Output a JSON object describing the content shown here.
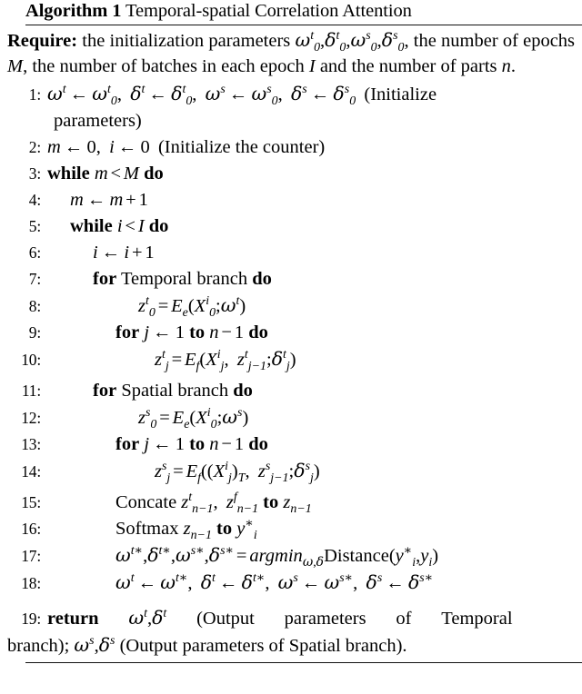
{
  "document": {
    "type": "algorithm-pseudocode",
    "title_keyword": "Algorithm",
    "title_number": "1",
    "title_name": "Temporal-spatial Correlation Attention",
    "full_title": "Algorithm 1 Temporal-spatial Correlation Attention"
  },
  "require": {
    "keyword": "Require:",
    "text": "the initialization parameters ω0t, δ0t, ω0s, δ0s, the number of epochs M, the number of batches in each epoch I and the number of parts n.",
    "segments": {
      "s1": "the",
      "s2": "initialization",
      "s3": "parameters",
      "s4": ", the number of epochs",
      "s5": ", the number of batches in each epoch",
      "s6": "and the number of parts",
      "s7": "."
    },
    "symbols": {
      "omega_0_t": "ω0t",
      "delta_0_t": "δ0t",
      "omega_0_s": "ω0s",
      "delta_0_s": "δ0s",
      "M": "M",
      "I": "I",
      "n": "n"
    }
  },
  "lines": [
    {
      "num": "1:",
      "indent": 0,
      "text": "ωt ← ω0t, δt ← δ0t, ωs ← ω0s, δs ← δ0s (Initialize parameters)",
      "comment": "(Initialize parameters)"
    },
    {
      "num": "2:",
      "indent": 0,
      "text": "m ← 0, i ← 0 (Initialize the counter)",
      "comment": "(Initialize the counter)"
    },
    {
      "num": "3:",
      "indent": 0,
      "keywords": [
        "while",
        "do"
      ],
      "text": "while m < M do"
    },
    {
      "num": "4:",
      "indent": 1,
      "text": "m ← m + 1"
    },
    {
      "num": "5:",
      "indent": 1,
      "keywords": [
        "while",
        "do"
      ],
      "text": "while i < I do"
    },
    {
      "num": "6:",
      "indent": 2,
      "text": "i ← i + 1"
    },
    {
      "num": "7:",
      "indent": 2,
      "keywords": [
        "for",
        "do"
      ],
      "label": "Temporal branch",
      "text": "for Temporal branch do"
    },
    {
      "num": "8:",
      "indent": 3,
      "text": "z0t = Ee(X0i; ωt)"
    },
    {
      "num": "9:",
      "indent": 3,
      "keywords": [
        "for",
        "to",
        "do"
      ],
      "text": "for j ← 1 to n − 1 do"
    },
    {
      "num": "10:",
      "indent": 4,
      "text": "zjt = Ef(Xji, zj−1t; δjt)"
    },
    {
      "num": "11:",
      "indent": 2,
      "keywords": [
        "for",
        "do"
      ],
      "label": "Spatial branch",
      "text": "for Spatial branch do"
    },
    {
      "num": "12:",
      "indent": 3,
      "text": "z0s = Ee(X0i; ωs)"
    },
    {
      "num": "13:",
      "indent": 3,
      "keywords": [
        "for",
        "to",
        "do"
      ],
      "text": "for j ← 1 to n − 1 do"
    },
    {
      "num": "14:",
      "indent": 4,
      "text": "zjs = Ef((Xji)T, zj−1s; δjs)"
    },
    {
      "num": "15:",
      "indent": 3,
      "keywords": [
        "to"
      ],
      "label": "Concate",
      "text": "Concate zn−1t, zn−1f to zn−1"
    },
    {
      "num": "16:",
      "indent": 3,
      "keywords": [
        "to"
      ],
      "label": "Softmax",
      "text": "Softmax zn−1 to yi*"
    },
    {
      "num": "17:",
      "indent": 3,
      "text": "ωt*, δt*, ωs*, δs* = argminω,δ Distance(yi*, yi)"
    },
    {
      "num": "18:",
      "indent": 3,
      "text": "ωt ← ωt*, δt ← δt*, ωs ← ωs*, δs ← δs*"
    },
    {
      "num": "19:",
      "indent": 0,
      "keywords": [
        "return"
      ],
      "text": "return ωt, δt (Output parameters of Temporal branch); ωs, δs (Output parameters of Spatial branch).",
      "comment_a": "(Output parameters of Temporal branch);",
      "comment_b": "(Output parameters of Spatial branch)."
    }
  ],
  "words": {
    "while": "while",
    "do": "do",
    "for": "for",
    "to": "to",
    "return": "return",
    "concate": "Concate",
    "softmax": "Softmax",
    "distance": "Distance",
    "argmin": "argmin",
    "temporal_branch": "Temporal branch",
    "spatial_branch": "Spatial branch",
    "initialize_parameters_open": "(Initialize",
    "initialize_parameters_close": "parameters)",
    "initialize_counter": "(Initialize the counter)",
    "output_params_temporal": "(Output",
    "out_params": "parameters",
    "out_of": "of",
    "out_temporal": "Temporal",
    "branch_semi": "branch);",
    "output_params_spatial": "(Output parameters of Spatial branch)."
  },
  "nums": {
    "n1": "1:",
    "n2": "2:",
    "n3": "3:",
    "n4": "4:",
    "n5": "5:",
    "n6": "6:",
    "n7": "7:",
    "n8": "8:",
    "n9": "9:",
    "n10": "10:",
    "n11": "11:",
    "n12": "12:",
    "n13": "13:",
    "n14": "14:",
    "n15": "15:",
    "n16": "16:",
    "n17": "17:",
    "n18": "18:",
    "n19": "19:"
  },
  "colors": {
    "text": "#000000",
    "background": "#ffffff",
    "rule": "#111111"
  }
}
